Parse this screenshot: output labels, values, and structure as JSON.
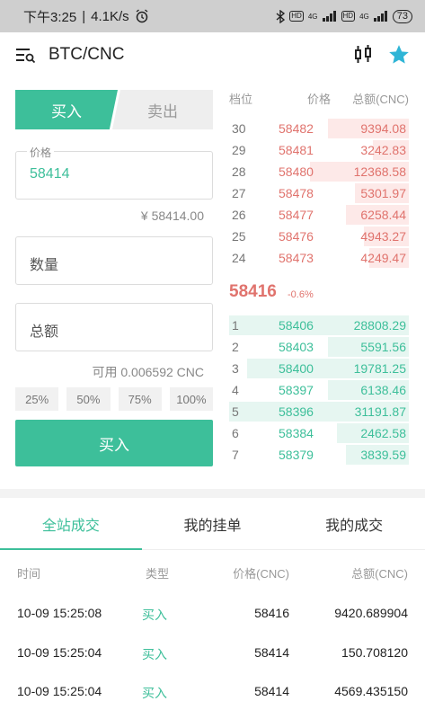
{
  "status_bar": {
    "time": "下午3:25",
    "speed": "4.1K/s",
    "battery": "73",
    "net_badge_1": "HD",
    "net_badge_2": "HD",
    "net_type_1": "4G",
    "net_type_2": "4G"
  },
  "header": {
    "title": "BTC/CNC"
  },
  "trade_tabs": {
    "buy": "买入",
    "sell": "卖出"
  },
  "form": {
    "price_label": "价格",
    "price_value": "58414",
    "price_cny": "¥ 58414.00",
    "amount_placeholder": "数量",
    "total_placeholder": "总额",
    "available": "可用 0.006592 CNC",
    "percents": [
      "25%",
      "50%",
      "75%",
      "100%"
    ],
    "buy_button": "买入"
  },
  "order_book": {
    "headers": {
      "level": "档位",
      "price": "价格",
      "total": "总额(CNC)"
    },
    "asks": [
      {
        "level": "30",
        "price": "58482",
        "total": "9394.08",
        "depth": 0.45
      },
      {
        "level": "29",
        "price": "58481",
        "total": "3242.83",
        "depth": 0.2
      },
      {
        "level": "28",
        "price": "58480",
        "total": "12368.58",
        "depth": 0.55
      },
      {
        "level": "27",
        "price": "58478",
        "total": "5301.97",
        "depth": 0.3
      },
      {
        "level": "26",
        "price": "58477",
        "total": "6258.44",
        "depth": 0.35
      },
      {
        "level": "25",
        "price": "58476",
        "total": "4943.27",
        "depth": 0.25
      },
      {
        "level": "24",
        "price": "58473",
        "total": "4249.47",
        "depth": 0.22
      }
    ],
    "last_price": "58416",
    "last_change": "-0.6%",
    "bids": [
      {
        "level": "1",
        "price": "58406",
        "total": "28808.29",
        "depth": 1.0
      },
      {
        "level": "2",
        "price": "58403",
        "total": "5591.56",
        "depth": 0.45
      },
      {
        "level": "3",
        "price": "58400",
        "total": "19781.25",
        "depth": 0.9
      },
      {
        "level": "4",
        "price": "58397",
        "total": "6138.46",
        "depth": 0.45
      },
      {
        "level": "5",
        "price": "58396",
        "total": "31191.87",
        "depth": 1.0
      },
      {
        "level": "6",
        "price": "58384",
        "total": "2462.58",
        "depth": 0.4
      },
      {
        "level": "7",
        "price": "58379",
        "total": "3839.59",
        "depth": 0.35
      }
    ]
  },
  "bottom_tabs": [
    "全站成交",
    "我的挂单",
    "我的成交"
  ],
  "trades": {
    "headers": {
      "time": "时间",
      "type": "类型",
      "price": "价格(CNC)",
      "total": "总额(CNC)"
    },
    "rows": [
      {
        "time": "10-09 15:25:08",
        "type": "买入",
        "price": "58416",
        "total": "9420.689904"
      },
      {
        "time": "10-09 15:25:04",
        "type": "买入",
        "price": "58414",
        "total": "150.708120"
      },
      {
        "time": "10-09 15:25:04",
        "type": "买入",
        "price": "58414",
        "total": "4569.435150"
      }
    ]
  },
  "colors": {
    "accent": "#3dbf9a",
    "ask": "#e0736d"
  }
}
